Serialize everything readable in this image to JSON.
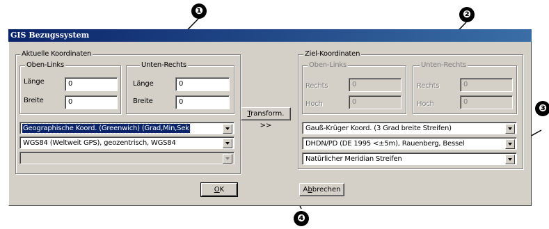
{
  "window": {
    "title": "GIS Bezugssystem"
  },
  "source": {
    "group_label": "Aktuelle Koordinaten",
    "top_left": {
      "label": "Oben-Links",
      "length_label": "Länge",
      "length_value": "0",
      "width_label": "Breite",
      "width_value": "0"
    },
    "bottom_right": {
      "label": "Unten-Rechts",
      "length_label": "Länge",
      "length_value": "0",
      "width_label": "Breite",
      "width_value": "0"
    },
    "system": "Geographische Koord. (Greenwich) (Grad,Min,Sek)",
    "datum": "WGS84 (Weltweit GPS), geozentrisch, WGS84",
    "extra": ""
  },
  "target": {
    "group_label": "Ziel-Koordinaten",
    "top_left": {
      "label": "Oben-Links",
      "right_label": "Rechts",
      "right_value": "0",
      "high_label": "Hoch",
      "high_value": "0"
    },
    "bottom_right": {
      "label": "Unten-Rechts",
      "right_label": "Rechts",
      "right_value": "0",
      "high_label": "Hoch",
      "high_value": "0"
    },
    "system": "Gauß-Krüger Koord. (3 Grad breite Streifen)",
    "datum": "DHDN/PD (DE 1995 <±5m), Rauenberg, Bessel",
    "meridian": "Natürlicher Meridian Streifen"
  },
  "buttons": {
    "transform_mnemonic": "T",
    "transform_rest": "ransform. >>",
    "ok_mnemonic": "O",
    "ok_rest": "K",
    "cancel_pre": "A",
    "cancel_mnemonic": "b",
    "cancel_rest": "brechen"
  },
  "callouts": {
    "one": "❶",
    "two": "❷",
    "three": "❸",
    "four": "❹"
  }
}
